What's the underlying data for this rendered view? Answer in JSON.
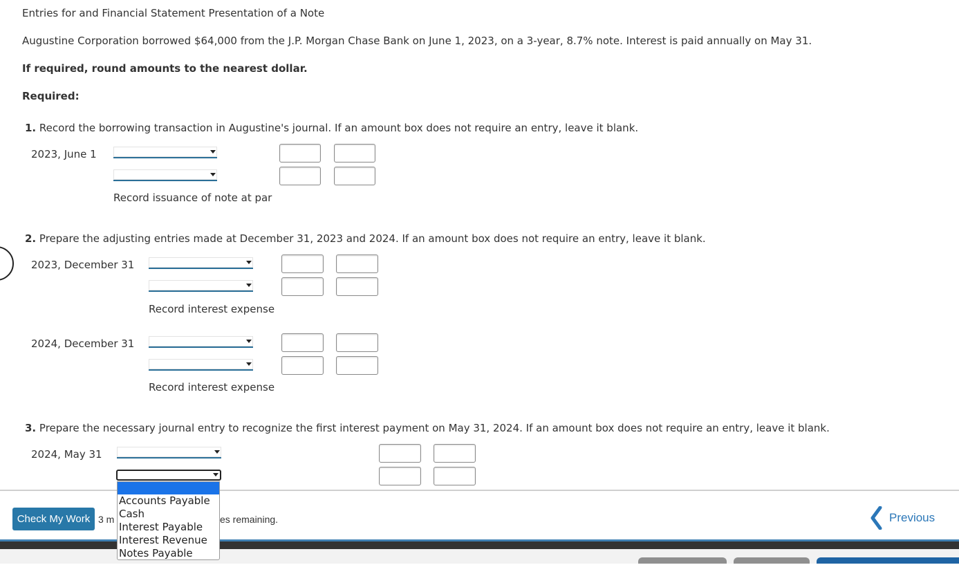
{
  "title": "Entries for and Financial Statement Presentation of a Note",
  "intro": "Augustine Corporation borrowed $64,000 from the J.P. Morgan Chase Bank on June 1, 2023, on a 3-year, 8.7% note. Interest is paid annually on May 31.",
  "rounding": "If required, round amounts to the nearest dollar.",
  "required": "Required:",
  "q1": {
    "num": "1.",
    "text": "Record the borrowing transaction in Augustine's journal. If an amount box does not require an entry, leave it blank.",
    "date": "2023, June 1",
    "note": "Record issuance of note at par"
  },
  "q2": {
    "num": "2.",
    "text": "Prepare the adjusting entries made at December 31, 2023 and 2024. If an amount box does not require an entry, leave it blank.",
    "date1": "2023, December 31",
    "note1": "Record interest expense",
    "date2": "2024, December 31",
    "note2": "Record interest expense"
  },
  "q3": {
    "num": "3.",
    "text": "Prepare the necessary journal entry to recognize the first interest payment on May 31, 2024. If an amount box does not require an entry, leave it blank.",
    "date": "2024, May 31"
  },
  "dropdown_options": [
    "Accounts Payable",
    "Cash",
    "Interest Payable",
    "Interest Revenue",
    "Notes Payable"
  ],
  "footer": {
    "check_label": "Check My Work",
    "attempts_prefix": "3 m",
    "attempts_suffix": "es remaining.",
    "previous_label": "Previous"
  }
}
